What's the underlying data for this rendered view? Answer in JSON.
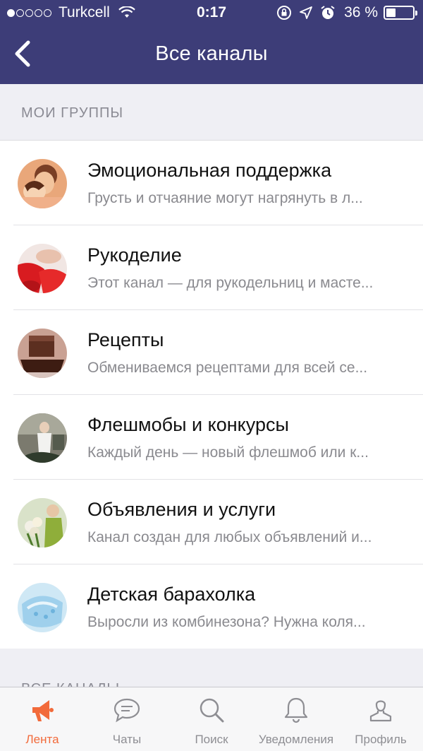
{
  "status_bar": {
    "carrier": "Turkcell",
    "time": "0:17",
    "battery": "36 %",
    "battery_level": 0.36,
    "signal_dots_filled": 1
  },
  "nav": {
    "title": "Все каналы",
    "back_icon": "chevron-left-icon"
  },
  "my_groups": {
    "header": "МОИ ГРУППЫ",
    "items": [
      {
        "title": "Эмоциональная поддержка",
        "subtitle": "Грусть и отчаяние могут нагрянуть в л..."
      },
      {
        "title": "Рукоделие",
        "subtitle": "Этот канал — для рукодельниц и масте..."
      },
      {
        "title": "Рецепты",
        "subtitle": "Обмениваемся рецептами для всей се..."
      },
      {
        "title": "Флешмобы и конкурсы",
        "subtitle": "Каждый день — новый флешмоб или к..."
      },
      {
        "title": "Объявления и услуги",
        "subtitle": "Канал создан для любых объявлений и..."
      },
      {
        "title": "Детская барахолка",
        "subtitle": "Выросли из комбинезона? Нужна коля..."
      }
    ]
  },
  "all_channels": {
    "header": "ВСЕ КАНАЛЫ"
  },
  "tabbar": {
    "tabs": [
      {
        "label": "Лента",
        "icon": "megaphone-icon",
        "active": true
      },
      {
        "label": "Чаты",
        "icon": "chat-bubble-icon",
        "active": false
      },
      {
        "label": "Поиск",
        "icon": "search-icon",
        "active": false
      },
      {
        "label": "Уведомления",
        "icon": "bell-icon",
        "active": false
      },
      {
        "label": "Профиль",
        "icon": "person-icon",
        "active": false
      }
    ]
  },
  "colors": {
    "nav_bg": "#3d3d78",
    "accent": "#f26a3a",
    "tab_inactive": "#8e8e93"
  }
}
